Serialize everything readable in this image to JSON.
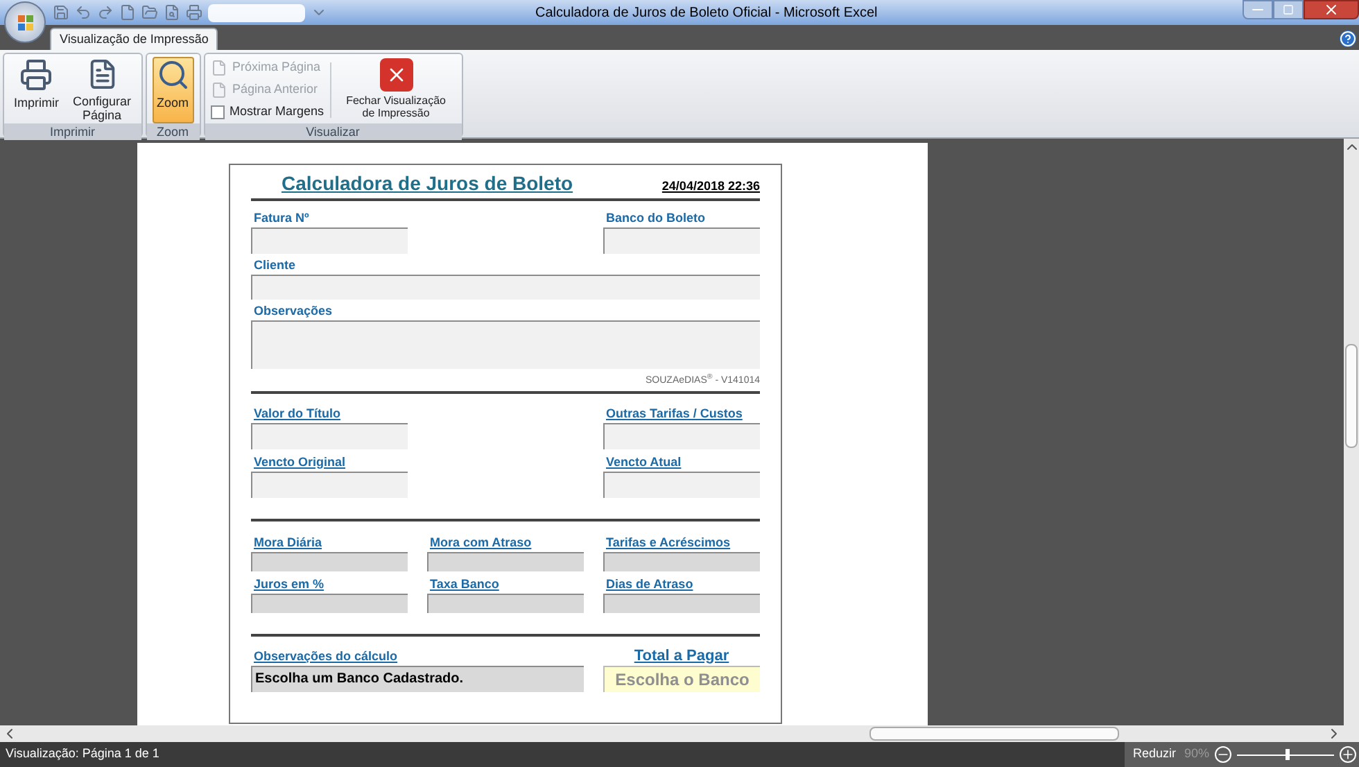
{
  "window": {
    "title": "Calculadora de Juros de Boleto Oficial - Microsoft Excel"
  },
  "tabs": [
    {
      "label": "Visualização de Impressão",
      "selected": true
    }
  ],
  "ribbon": {
    "groups": [
      {
        "label": "Imprimir",
        "items": [
          {
            "kind": "large",
            "label": "Imprimir",
            "selected": false
          },
          {
            "kind": "large",
            "label": "Configurar Página",
            "selected": false
          }
        ]
      },
      {
        "label": "Zoom",
        "items": [
          {
            "kind": "large",
            "label": "Zoom",
            "selected": true
          }
        ]
      },
      {
        "label": "Visualizar",
        "items": [
          {
            "kind": "small",
            "label": "Próxima Página",
            "disabled": true
          },
          {
            "kind": "small",
            "label": "Página Anterior",
            "disabled": true
          },
          {
            "kind": "check",
            "label": "Mostrar Margens",
            "checked": false
          },
          {
            "kind": "large",
            "label": "Fechar Visualização de Impressão",
            "selected": false
          }
        ]
      }
    ]
  },
  "form": {
    "title": "Calculadora de Juros de Boleto",
    "datetime": "24/04/2018 22:36",
    "version": "SOUZAeDIAS$^{®}$ - V141014",
    "sections": [
      {
        "underlined": false,
        "rows": [
          {
            "kind": "pair",
            "fields": [
              {
                "label": "Fatura Nº",
                "kind": "input"
              },
              {
                "label": "Banco do Boleto",
                "kind": "input"
              }
            ]
          },
          {
            "kind": "full",
            "fields": [
              {
                "label": "Cliente",
                "kind": "input"
              }
            ]
          },
          {
            "kind": "notes",
            "fields": [
              {
                "label": "Observações",
                "kind": "input"
              }
            ]
          }
        ]
      },
      {
        "underlined": true,
        "rows": [
          {
            "kind": "pair",
            "fields": [
              {
                "label": "Valor do Título",
                "kind": "input"
              },
              {
                "label": "Outras Tarifas / Custos",
                "kind": "input"
              }
            ]
          },
          {
            "kind": "pair",
            "fields": [
              {
                "label": "Vencto Original",
                "kind": "input"
              },
              {
                "label": "Vencto Atual",
                "kind": "input"
              }
            ]
          }
        ]
      },
      {
        "underlined": true,
        "rows": [
          {
            "kind": "triple",
            "fields": [
              {
                "label": "Mora Diária",
                "kind": "computed"
              },
              {
                "label": "Mora com Atraso",
                "kind": "computed"
              },
              {
                "label": "Tarifas e Acréscimos",
                "kind": "computed"
              }
            ]
          },
          {
            "kind": "triple",
            "fields": [
              {
                "label": "Juros em %",
                "kind": "computed"
              },
              {
                "label": "Taxa Banco",
                "kind": "computed"
              },
              {
                "label": "Dias de Atraso",
                "kind": "computed"
              }
            ]
          }
        ]
      },
      {
        "underlined": true,
        "rows": [
          {
            "kind": "summary",
            "fields": [
              {
                "label": "Observações do cálculo",
                "kind": "computed",
                "value": "Escolha um Banco Cadastrado."
              },
              {
                "label": "Total a Pagar",
                "kind": "total",
                "value": "Escolha o Banco"
              }
            ]
          }
        ]
      }
    ]
  },
  "status_bar": {
    "text": "Visualização: Página 1 de 1",
    "zoom_button": "Reduzir",
    "zoom_value": "90%",
    "zoom_slider": {
      "level": 0.5
    }
  }
}
